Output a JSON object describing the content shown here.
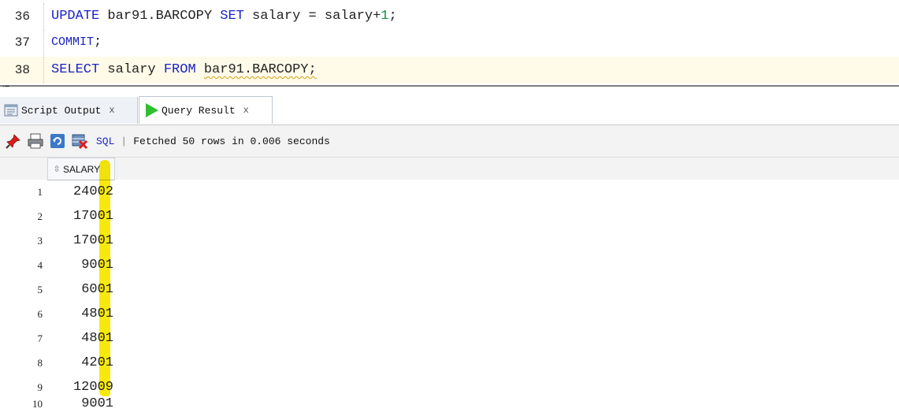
{
  "editor": {
    "lines": [
      {
        "num": "36",
        "parts": [
          {
            "t": "UPDATE",
            "c": "kw"
          },
          {
            "t": " bar91.BARCOPY ",
            "c": ""
          },
          {
            "t": "SET",
            "c": "kw"
          },
          {
            "t": " salary = salary+",
            "c": ""
          },
          {
            "t": "1",
            "c": "num"
          },
          {
            "t": ";",
            "c": ""
          }
        ]
      },
      {
        "num": "37",
        "parts": [
          {
            "t": "COMMIT",
            "c": "kw kw-small"
          },
          {
            "t": ";",
            "c": ""
          }
        ]
      },
      {
        "num": "38",
        "parts": [
          {
            "t": "SELECT",
            "c": "kw"
          },
          {
            "t": " salary ",
            "c": ""
          },
          {
            "t": "FROM",
            "c": "kw"
          },
          {
            "t": " ",
            "c": ""
          },
          {
            "t": "bar91.BARCOPY;",
            "c": "squiggle"
          }
        ]
      }
    ]
  },
  "tabs": {
    "script_output": {
      "label": "Script Output",
      "close": "x"
    },
    "query_result": {
      "label": "Query Result",
      "close": "x"
    }
  },
  "toolbar": {
    "sql_label": "SQL",
    "separator": "|",
    "status": "Fetched 50 rows in 0.006 seconds"
  },
  "grid": {
    "column": "SALARY",
    "rows": [
      {
        "n": "1",
        "v": "24002"
      },
      {
        "n": "2",
        "v": "17001"
      },
      {
        "n": "3",
        "v": "17001"
      },
      {
        "n": "4",
        "v": "9001"
      },
      {
        "n": "5",
        "v": "6001"
      },
      {
        "n": "6",
        "v": "4801"
      },
      {
        "n": "7",
        "v": "4801"
      },
      {
        "n": "8",
        "v": "4201"
      },
      {
        "n": "9",
        "v": "12009"
      },
      {
        "n": "10",
        "v": "9001"
      }
    ]
  },
  "colors": {
    "keyword": "#1a22c8",
    "number": "#14903b",
    "highlight": "#f7e800",
    "current_line": "#fffbe8"
  }
}
